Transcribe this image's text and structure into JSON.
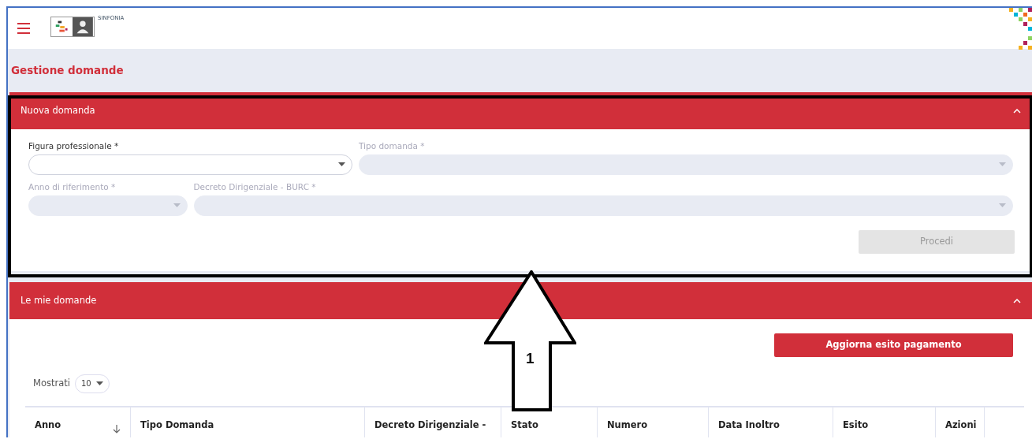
{
  "header": {
    "brand": "SINFONIA"
  },
  "page_title": "Gestione domande",
  "panels": [
    {
      "title": "Nuova domanda",
      "expanded": true,
      "kind": "form",
      "rows": [
        [
          {
            "label": "Figura professionale *",
            "disabled": false
          },
          {
            "label": "Tipo domanda *",
            "disabled": true
          }
        ],
        [
          {
            "label": "Anno di riferimento *",
            "disabled": true
          },
          {
            "label": "Decreto Dirigenziale - BURC *",
            "disabled": true
          }
        ]
      ],
      "button": {
        "label": "Procedi",
        "disabled": true
      }
    },
    {
      "title": "Le mie domande",
      "expanded": true,
      "kind": "table",
      "button": {
        "label": "Aggiorna esito pagamento",
        "disabled": false
      },
      "page_size": {
        "label": "Mostrati",
        "value": "10"
      },
      "columns": [
        {
          "label": "Anno",
          "sortable": true
        },
        {
          "label": "Tipo Domanda",
          "sortable": false
        },
        {
          "label": "Decreto Dirigenziale -",
          "sortable": false
        },
        {
          "label": "Stato",
          "sortable": false
        },
        {
          "label": "Numero",
          "sortable": false
        },
        {
          "label": "Data Inoltro",
          "sortable": false
        },
        {
          "label": "Esito",
          "sortable": false
        },
        {
          "label": "Azioni",
          "sortable": false
        }
      ]
    }
  ],
  "annotation": {
    "label": "1"
  }
}
